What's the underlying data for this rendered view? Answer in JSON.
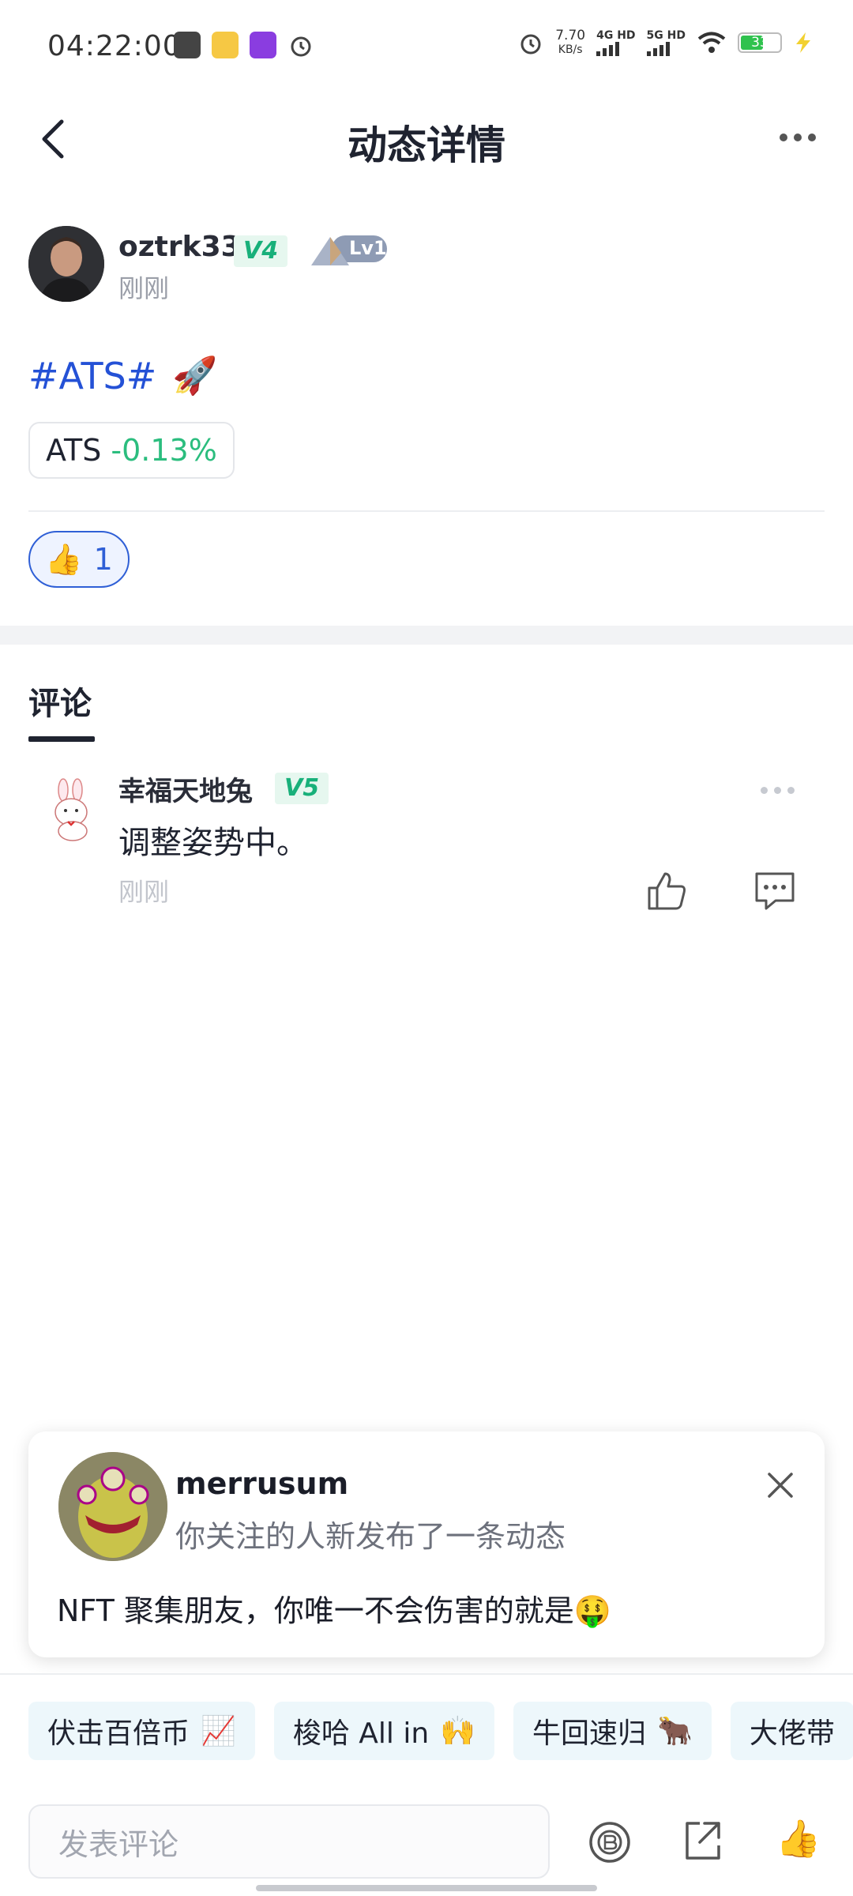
{
  "status_bar": {
    "time": "04:22:00",
    "speed_value": "7.70",
    "speed_unit": "KB/s",
    "net1": "4G HD",
    "net2": "5G HD",
    "battery": "33"
  },
  "header": {
    "title": "动态详情"
  },
  "post": {
    "author": "oztrk33",
    "vip_level": "V4",
    "user_level": "Lv1",
    "time": "刚刚",
    "hashtag": "#ATS#",
    "emoji": "🚀",
    "coin_symbol": "ATS",
    "coin_change": "-0.13%",
    "like_emoji": "👍",
    "like_count": "1"
  },
  "comments_section": {
    "tab_label": "评论",
    "items": [
      {
        "author": "幸福天地兔",
        "vip_level": "V5",
        "text": "调整姿势中。",
        "time": "刚刚"
      }
    ]
  },
  "notification": {
    "name": "merrusum",
    "subtitle": "你关注的人新发布了一条动态",
    "message": "NFT 聚集朋友，你唯一不会伤害的就是🤑"
  },
  "quick_replies": [
    {
      "label": "伏击百倍币",
      "emoji": "📈"
    },
    {
      "label": "梭哈 All in",
      "emoji": "🙌"
    },
    {
      "label": "牛回速归",
      "emoji": "🐂"
    },
    {
      "label": "大佬带",
      "emoji": ""
    }
  ],
  "input": {
    "placeholder": "发表评论",
    "thumb_emoji": "👍"
  },
  "colors": {
    "link_blue": "#2451d6",
    "gain_green": "#2bbd7e",
    "vip_green": "#18b07a",
    "like_blue": "#2f5fd6"
  }
}
